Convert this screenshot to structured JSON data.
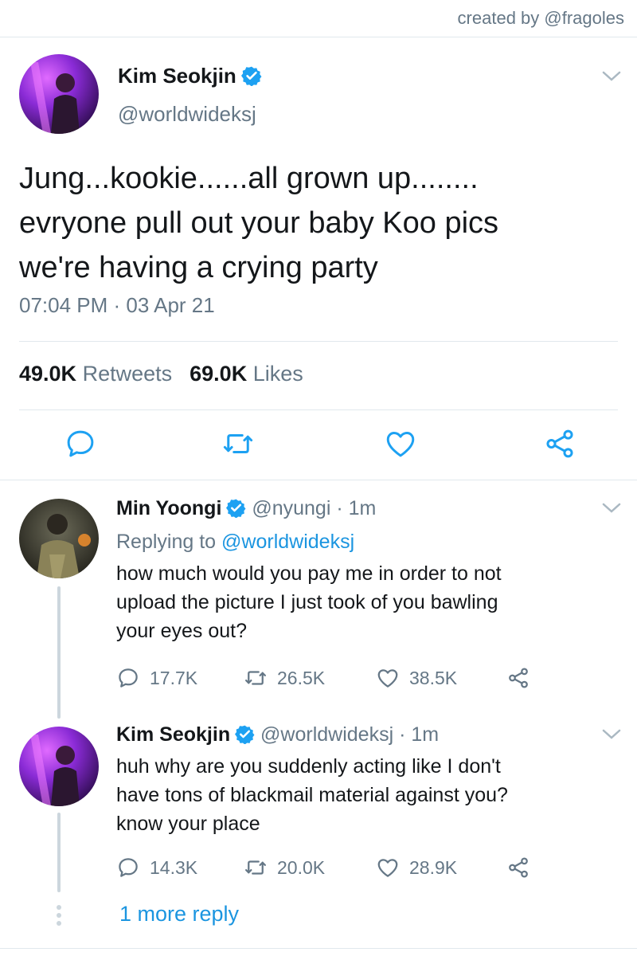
{
  "credit": "created by @fragoles",
  "main_tweet": {
    "name": "Kim Seokjin",
    "handle": "@worldwideksj",
    "text_lines": [
      "Jung...kookie......all grown up........",
      "evryone pull out your baby Koo pics",
      "we're having a crying party"
    ],
    "timestamp": "07:04 PM · 03 Apr 21",
    "retweets_count": "49.0K",
    "retweets_label": "Retweets",
    "likes_count": "69.0K",
    "likes_label": "Likes"
  },
  "replies": [
    {
      "name": "Min Yoongi",
      "handle": "@nyungi",
      "time": "· 1m",
      "replying_prefix": "Replying to",
      "replying_to": "@worldwideksj",
      "text_lines": [
        "how much would you pay me in order to not",
        "upload the picture I just took of you bawling",
        "your eyes out?"
      ],
      "replies": "17.7K",
      "retweets": "26.5K",
      "likes": "38.5K"
    },
    {
      "name": "Kim Seokjin",
      "handle": "@worldwideksj",
      "time": "· 1m",
      "text_lines": [
        "huh why are you suddenly acting like I don't",
        "have tons of blackmail material against you?",
        "know your place"
      ],
      "replies": "14.3K",
      "retweets": "20.0K",
      "likes": "28.9K"
    }
  ],
  "more_replies": "1 more reply",
  "colors": {
    "verified": "#1da1f2",
    "link": "#1b95e0",
    "muted": "#657786",
    "divider": "#e1e8ed"
  },
  "icons": [
    "chevron-down-icon",
    "verified-badge-icon",
    "reply-icon",
    "retweet-icon",
    "like-icon",
    "share-icon"
  ]
}
